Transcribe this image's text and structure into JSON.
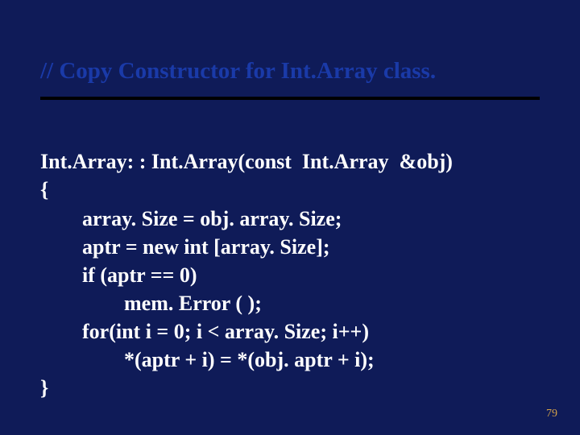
{
  "slide": {
    "title": "// Copy Constructor for Int.Array class.",
    "code_lines": {
      "l0": "Int.Array: : Int.Array(const  Int.Array  &obj)",
      "l1": "{",
      "l2": "        array. Size = obj. array. Size;",
      "l3": "        aptr = new int [array. Size];",
      "l4": "        if (aptr == 0)",
      "l5": "                mem. Error ( );",
      "l6": "        for(int i = 0; i < array. Size; i++)",
      "l7": "                *(aptr + i) = *(obj. aptr + i);",
      "l8": "}"
    },
    "page_number": "79"
  }
}
